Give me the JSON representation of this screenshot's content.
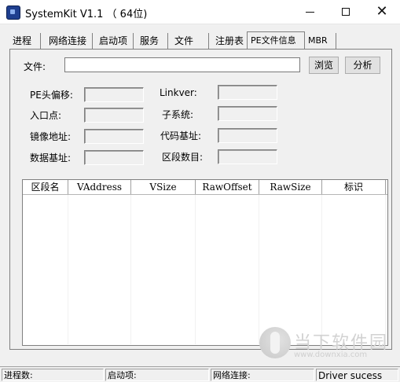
{
  "window": {
    "title": "SystemKit V1.1 （  64位)",
    "min_icon": "minimize-icon",
    "max_icon": "maximize-icon",
    "close_icon": "close-icon"
  },
  "tabs": [
    {
      "label": "进程"
    },
    {
      "label": "网络连接"
    },
    {
      "label": "启动项"
    },
    {
      "label": "服务"
    },
    {
      "label": "文件"
    },
    {
      "label": "注册表"
    },
    {
      "label": "PE文件信息"
    },
    {
      "label": "MBR"
    }
  ],
  "pe": {
    "file_label": "文件:",
    "file_value": "",
    "browse_label": "浏览",
    "analyze_label": "分析",
    "fields_left": [
      {
        "label": "PE头偏移:",
        "value": ""
      },
      {
        "label": "入口点:",
        "value": ""
      },
      {
        "label": "镜像地址:",
        "value": ""
      },
      {
        "label": "数据基址:",
        "value": ""
      }
    ],
    "fields_right": [
      {
        "label": "Linkver:",
        "value": ""
      },
      {
        "label": "子系统:",
        "value": ""
      },
      {
        "label": "代码基址:",
        "value": ""
      },
      {
        "label": "区段数目:",
        "value": ""
      }
    ],
    "table_headers": [
      "区段名",
      "VAddress",
      "VSize",
      "RawOffset",
      "RawSize",
      "标识"
    ]
  },
  "status": {
    "process_count_label": "进程数:",
    "startup_label": "启动项:",
    "network_label": "网络连接:",
    "driver_status": "Driver sucess"
  },
  "watermark": {
    "text": "当下软件园",
    "url": "www.downxia.com"
  },
  "colors": {
    "panel_bg": "#f0f0f0",
    "accent": "#1f3f8f"
  }
}
